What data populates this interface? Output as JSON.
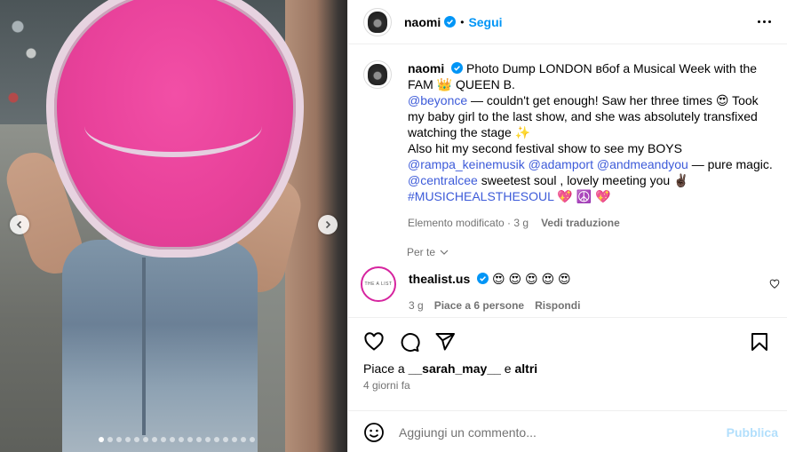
{
  "post": {
    "carousel": {
      "dot_count": 18,
      "active_index": 0,
      "prev_icon": "chevron-left-icon",
      "next_icon": "chevron-right-icon"
    },
    "header": {
      "username": "naomi",
      "separator": "•",
      "follow_label": "Segui",
      "more_icon": "more-horizontal-icon"
    },
    "caption": {
      "username": "naomi",
      "line1": "Photo Dump LONDON вбof a Musical Week with the FAM 👑 QUEEN B.",
      "mention_beyonce": "@beyonce",
      "line2": " — couldn't get enough! Saw her three times 😍 Took my baby girl to the last show, and she was absolutely transfixed watching the stage ✨",
      "line3": "Also hit my second festival show to see my BOYS",
      "mention_rampa": "@rampa_keinemusik",
      "mention_adamport": "@adamport",
      "mention_andmeandyou": "@andmeandyou",
      "line4": " — pure magic. ",
      "mention_centralcee": "@centralcee",
      "line5": " sweetest soul , lovely meeting you ✌🏿",
      "hashtag": "#MUSICHEALSTHESOUL",
      "hashtag_emoji": " 💖 ☮️ 💖",
      "edited_meta": "Elemento modificato · 3 g",
      "translate_label": "Vedi traduzione"
    },
    "for_you": {
      "label": "Per te",
      "icon": "chevron-down-icon"
    },
    "comment": {
      "avatar_text": "THE A LIST",
      "username": "thealist.us",
      "text": "😍 😍 😍 😍 😍",
      "age": "3 g",
      "likes": "Piace a 6 persone",
      "reply": "Rispondi"
    },
    "actions": {
      "like_icon": "heart-icon",
      "comment_icon": "comment-icon",
      "share_icon": "share-icon",
      "save_icon": "bookmark-icon",
      "likes_prefix": "Piace a ",
      "likes_user": "__sarah_may__",
      "likes_suffix": " e ",
      "likes_others": "altri",
      "date": "4 giorni fa"
    },
    "add_comment": {
      "emoji_icon": "emoji-icon",
      "placeholder": "Aggiungi un commento...",
      "publish_label": "Pubblica"
    },
    "colors": {
      "link": "#3d5bd9",
      "follow": "#0095f6",
      "publish_disabled": "#b2dffc",
      "hat_pink": "#e8419a"
    }
  }
}
